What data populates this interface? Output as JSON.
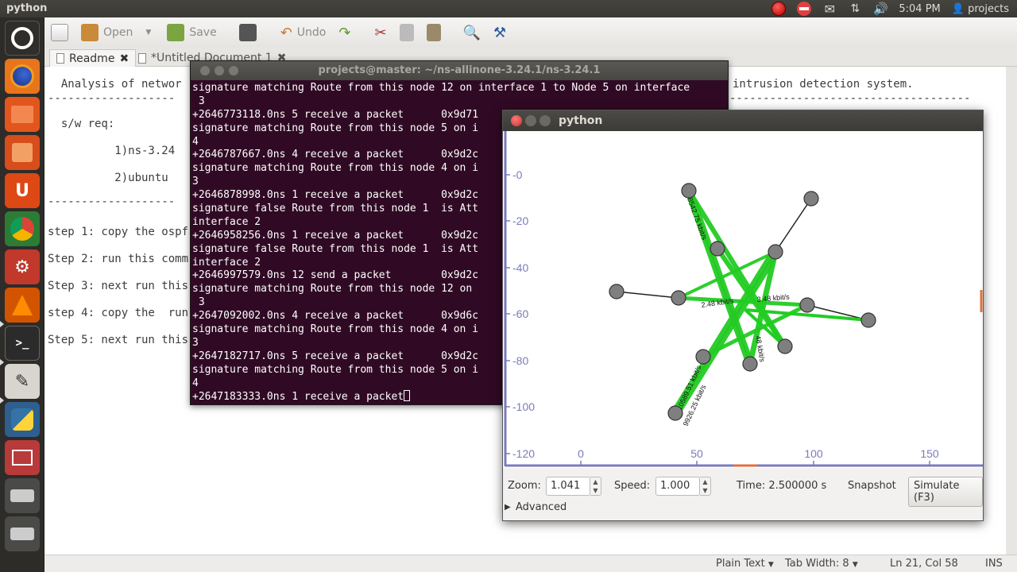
{
  "top_panel": {
    "app_title": "python",
    "clock": "5:04 PM",
    "user": "projects"
  },
  "launcher": {
    "items": [
      "dash-home",
      "firefox",
      "files",
      "software-center",
      "ubuntu-one",
      "chrome",
      "system-settings",
      "vlc",
      "terminal",
      "text-editor",
      "python",
      "workspaces",
      "drive",
      "drive",
      "trash"
    ]
  },
  "gedit": {
    "toolbar": {
      "open_label": "Open",
      "save_label": "Save",
      "undo_label": "Undo"
    },
    "tabs": [
      {
        "label": "Readme"
      },
      {
        "label": "*Untitled Document 1"
      }
    ],
    "lines": [
      "  Analysis of networ",
      "-------------------",
      "  s/w req:",
      "          1)ns-3.24",
      "          2)ubuntu ",
      "-------------------",
      "step 1: copy the ospf",
      "Step 2: run this comm",
      "Step 3: next run this",
      "step 4: copy the  run",
      "Step 5: next run this"
    ],
    "right_text": "intrusion detection system.",
    "right_dashes": "------------------------------------",
    "status": {
      "mode": "Plain Text",
      "tab_width": "Tab Width: 8",
      "position": "Ln 21, Col 58",
      "ins": "INS"
    }
  },
  "terminal": {
    "title": "projects@master: ~/ns-allinone-3.24.1/ns-3.24.1",
    "lines": [
      "signature matching Route from this node 12 on interface 1 to Node 5 on interface",
      " 3",
      "+2646773118.0ns 5 receive a packet      0x9d71",
      "signature matching Route from this node 5 on i",
      "4",
      "+2646787667.0ns 4 receive a packet      0x9d2c",
      "signature matching Route from this node 4 on i",
      "3",
      "+2646878998.0ns 1 receive a packet      0x9d2c",
      "signature false Route from this node 1  is Att",
      "interface 2",
      "+2646958256.0ns 1 receive a packet      0x9d2c",
      "signature false Route from this node 1  is Att",
      "interface 2",
      "+2646997579.0ns 12 send a packet        0x9d2c",
      "signature matching Route from this node 12 on",
      " 3",
      "+2647092002.0ns 4 receive a packet      0x9d6c",
      "signature matching Route from this node 4 on i",
      "3",
      "+2647182717.0ns 5 receive a packet      0x9d2c",
      "signature matching Route from this node 5 on i",
      "4",
      "+2647183333.0ns 1 receive a packet"
    ]
  },
  "visualizer": {
    "title": "python",
    "y_ticks": [
      "0",
      "20",
      "40",
      "60",
      "80",
      "100",
      "120"
    ],
    "x_ticks": [
      "0",
      "50",
      "100",
      "150"
    ],
    "link_labels": [
      "2.48 kbit/s",
      "3.48 kbit/s",
      "48 kbit/s",
      "8542.75 kbit/s",
      "10589.51 kbit/s",
      "9926.25 kbit/s"
    ],
    "controls": {
      "zoom_label": "Zoom:",
      "zoom_value": "1.041",
      "speed_label": "Speed:",
      "speed_value": "1.000",
      "time_label": "Time: 2.500000 s",
      "snapshot_label": "Snapshot",
      "simulate_label": "Simulate (F3)",
      "advanced_label": "Advanced"
    },
    "colors": {
      "flow": "#22cc22",
      "node": "#7f7f7f",
      "axis": "#7b7bbd"
    }
  }
}
